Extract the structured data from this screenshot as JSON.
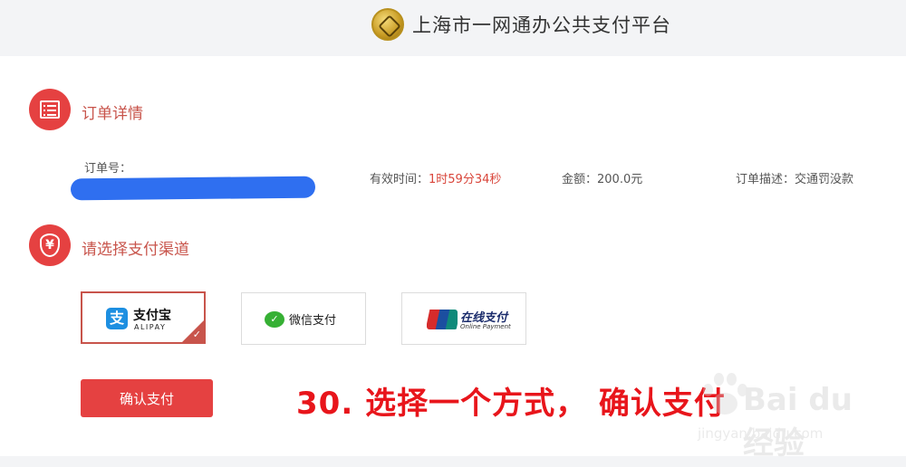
{
  "header": {
    "logo_icon": "seal-logo-icon",
    "title": "上海市一网通办公共支付平台"
  },
  "order_section": {
    "icon": "list-icon",
    "title": "订单详情",
    "order_no_label": "订单号：",
    "valid_time_label": "有效时间：",
    "valid_time_value": "1时59分34秒",
    "amount_label": "金额：",
    "amount_value": "200.0元",
    "desc_label": "订单描述：",
    "desc_value": "交通罚没款"
  },
  "channel_section": {
    "icon": "yen-shield-icon",
    "title": "请选择支付渠道",
    "options": [
      {
        "name": "支付宝",
        "sub": "ALIPAY",
        "icon_glyph": "支",
        "selected": true
      },
      {
        "name": "微信支付",
        "icon_glyph": "✓",
        "selected": false
      },
      {
        "name": "在线支付",
        "sub": "Online Payment",
        "selected": false
      }
    ]
  },
  "confirm_button": {
    "label": "确认支付"
  },
  "annotation": "30. 选择一个方式， 确认支付",
  "watermark": {
    "main": "Bai du 经验",
    "url": "jingyan.baidu.com"
  },
  "colors": {
    "accent": "#e54141",
    "section_title": "#c8544b",
    "annotation": "#e8151b"
  }
}
